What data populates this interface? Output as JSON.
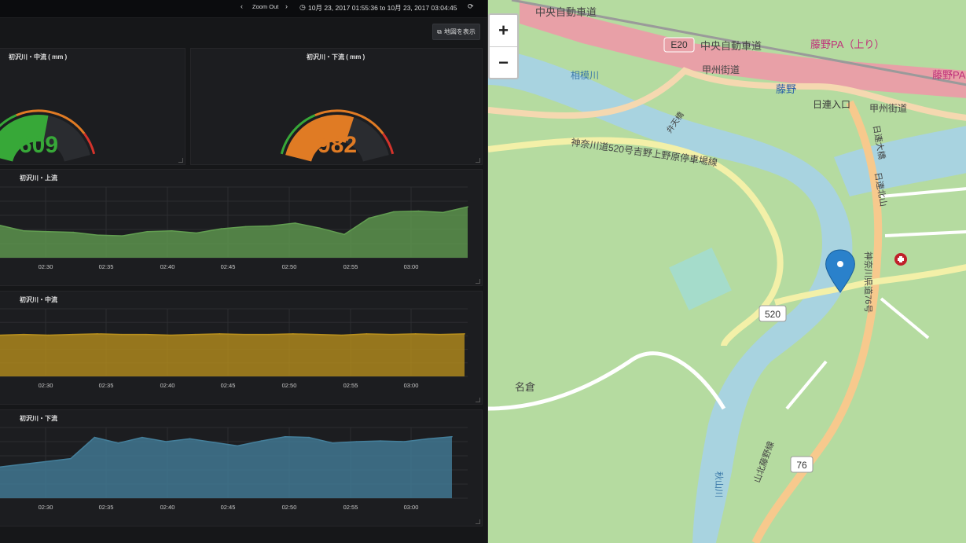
{
  "topbar": {
    "zoom_out_label": "Zoom Out",
    "time_range": "10月 23, 2017 01:55:36 to 10月 23, 2017 03:04:45"
  },
  "map_button": {
    "label": "地図を表示"
  },
  "gauges": [
    {
      "title": "初沢川・中流 ( mm )",
      "value": "609",
      "color": "#37a838"
    },
    {
      "title": "初沢川・下流 ( mm )",
      "value": "982",
      "color": "#e07b24"
    }
  ],
  "time_ticks": [
    "02:30",
    "02:35",
    "02:40",
    "02:45",
    "02:50",
    "02:55",
    "03:00"
  ],
  "chart_data": [
    {
      "type": "area",
      "title": "初沢川・上流",
      "x": [
        "02:26",
        "02:28",
        "02:30",
        "02:32",
        "02:34",
        "02:36",
        "02:38",
        "02:40",
        "02:42",
        "02:44",
        "02:46",
        "02:48",
        "02:50",
        "02:52",
        "02:54",
        "02:56",
        "02:58",
        "03:00",
        "03:02",
        "03:04"
      ],
      "series": [
        {
          "values": [
            46,
            38,
            37,
            36,
            32,
            31,
            37,
            38,
            35,
            41,
            44,
            45,
            49,
            42,
            33,
            56,
            65,
            66,
            64,
            72
          ],
          "color": "#629e51"
        }
      ],
      "ylim": [
        0,
        100
      ],
      "grid": true
    },
    {
      "type": "area",
      "title": "初沢川・中流",
      "x": [
        "02:26",
        "02:28",
        "02:30",
        "02:32",
        "02:34",
        "02:36",
        "02:38",
        "02:40",
        "02:42",
        "02:44",
        "02:46",
        "02:48",
        "02:50",
        "02:52",
        "02:54",
        "02:56",
        "02:58",
        "03:00",
        "03:02",
        "03:04"
      ],
      "series": [
        {
          "values": [
            61,
            62,
            61,
            62,
            63,
            62,
            62,
            61,
            62,
            63,
            62,
            62,
            63,
            62,
            61,
            63,
            62,
            63,
            62,
            63
          ],
          "color": "#b9901c"
        }
      ],
      "ylim": [
        0,
        100
      ],
      "grid": true
    },
    {
      "type": "area",
      "title": "初沢川・下流",
      "x": [
        "02:26",
        "02:28",
        "02:30",
        "02:32",
        "02:34",
        "02:36",
        "02:38",
        "02:40",
        "02:42",
        "02:44",
        "02:46",
        "02:48",
        "02:50",
        "02:52",
        "02:54",
        "02:56",
        "02:58",
        "03:00",
        "03:02",
        "03:04"
      ],
      "series": [
        {
          "values": [
            44,
            48,
            52,
            56,
            86,
            78,
            86,
            80,
            84,
            79,
            74,
            81,
            87,
            86,
            78,
            80,
            81,
            80,
            84,
            87
          ],
          "color": "#447f9b"
        }
      ],
      "ylim": [
        0,
        100
      ],
      "grid": true
    }
  ],
  "map": {
    "zoom_in": "+",
    "zoom_out": "−",
    "labels": {
      "expressway": "中央自動車道",
      "expressway2": "中央自動車道",
      "e20": "E20",
      "fujino_pa": "藤野PA（上り）",
      "fujino_pa2": "藤野PA",
      "koshu_kaido": "甲州街道",
      "koshu_kaido2": "甲州街道",
      "fujino": "藤野",
      "hikawa_entrance": "日連入口",
      "sagamigawa": "相模川",
      "bentenbashi": "弁天橋",
      "route520": "神奈川道520号吉野上野原停車場線",
      "hizure_ohashi": "日連大橋",
      "kanagawa_76": "神奈川県道76号",
      "num520": "520",
      "num76": "76",
      "nagura": "名倉",
      "akiyamagawa": "秋山川",
      "yamakita_fujino": "山北藤野線",
      "hizure_kita": "日連北山"
    }
  }
}
